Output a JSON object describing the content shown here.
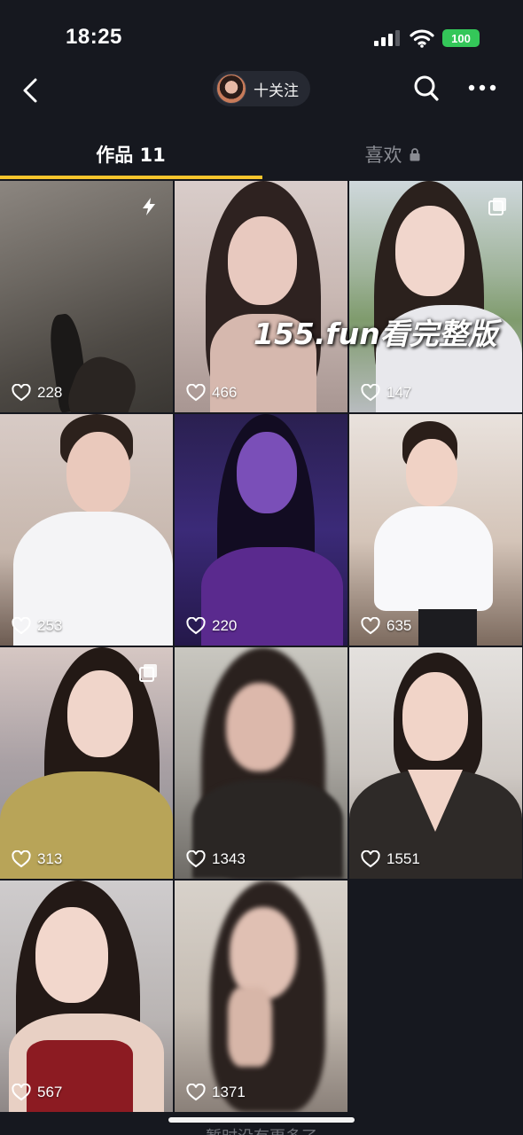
{
  "status_bar": {
    "time": "18:25",
    "battery": "100"
  },
  "header": {
    "follow_label": "十关注"
  },
  "tabs": [
    {
      "label": "作品 11",
      "active": true
    },
    {
      "label": "喜欢",
      "locked": true
    }
  ],
  "accent_color": "#f7c52c",
  "videos": [
    {
      "likes": "228",
      "badge": "lightning-icon"
    },
    {
      "likes": "466",
      "badge": ""
    },
    {
      "likes": "147",
      "badge": "multi-image-icon"
    },
    {
      "likes": "253",
      "badge": ""
    },
    {
      "likes": "220",
      "badge": ""
    },
    {
      "likes": "635",
      "badge": ""
    },
    {
      "likes": "313",
      "badge": "multi-image-icon"
    },
    {
      "likes": "1343",
      "badge": ""
    },
    {
      "likes": "1551",
      "badge": ""
    },
    {
      "likes": "567",
      "badge": ""
    },
    {
      "likes": "1371",
      "badge": ""
    }
  ],
  "watermark": "155.fun看完整版",
  "footer": {
    "text": "暂时没有更多了"
  }
}
